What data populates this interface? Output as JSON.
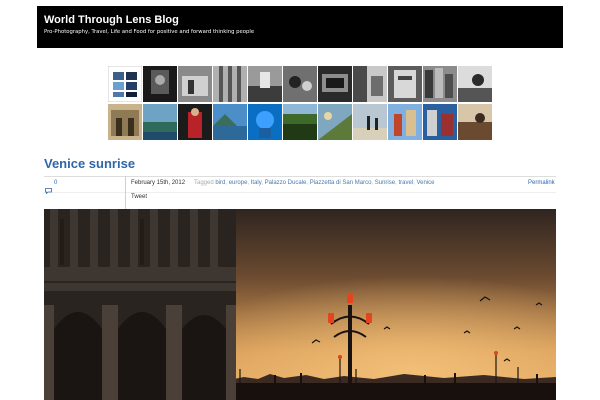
{
  "site": {
    "title": "World Through Lens Blog",
    "description": "Pro-Photography, Travel, Life and Food for positive and forward thinking people"
  },
  "colors": {
    "header_bg": "#000000",
    "link": "#2e67a8",
    "sky_top": "#3a2a1e",
    "sky_glow": "#e0a45a"
  },
  "post": {
    "title": "Venice sunrise",
    "comment_count": "0",
    "comment_icon": "speech-bubble-icon",
    "date": "February 15th, 2012",
    "tags_label": "Tagged",
    "tags": [
      "bird",
      "europe",
      "Italy",
      "Palazzo Ducale",
      "Piazzetta di San Marco",
      "Sunrise",
      "travel",
      "Venice"
    ],
    "permalink_label": "Permalink",
    "tweet_label": "Tweet"
  }
}
